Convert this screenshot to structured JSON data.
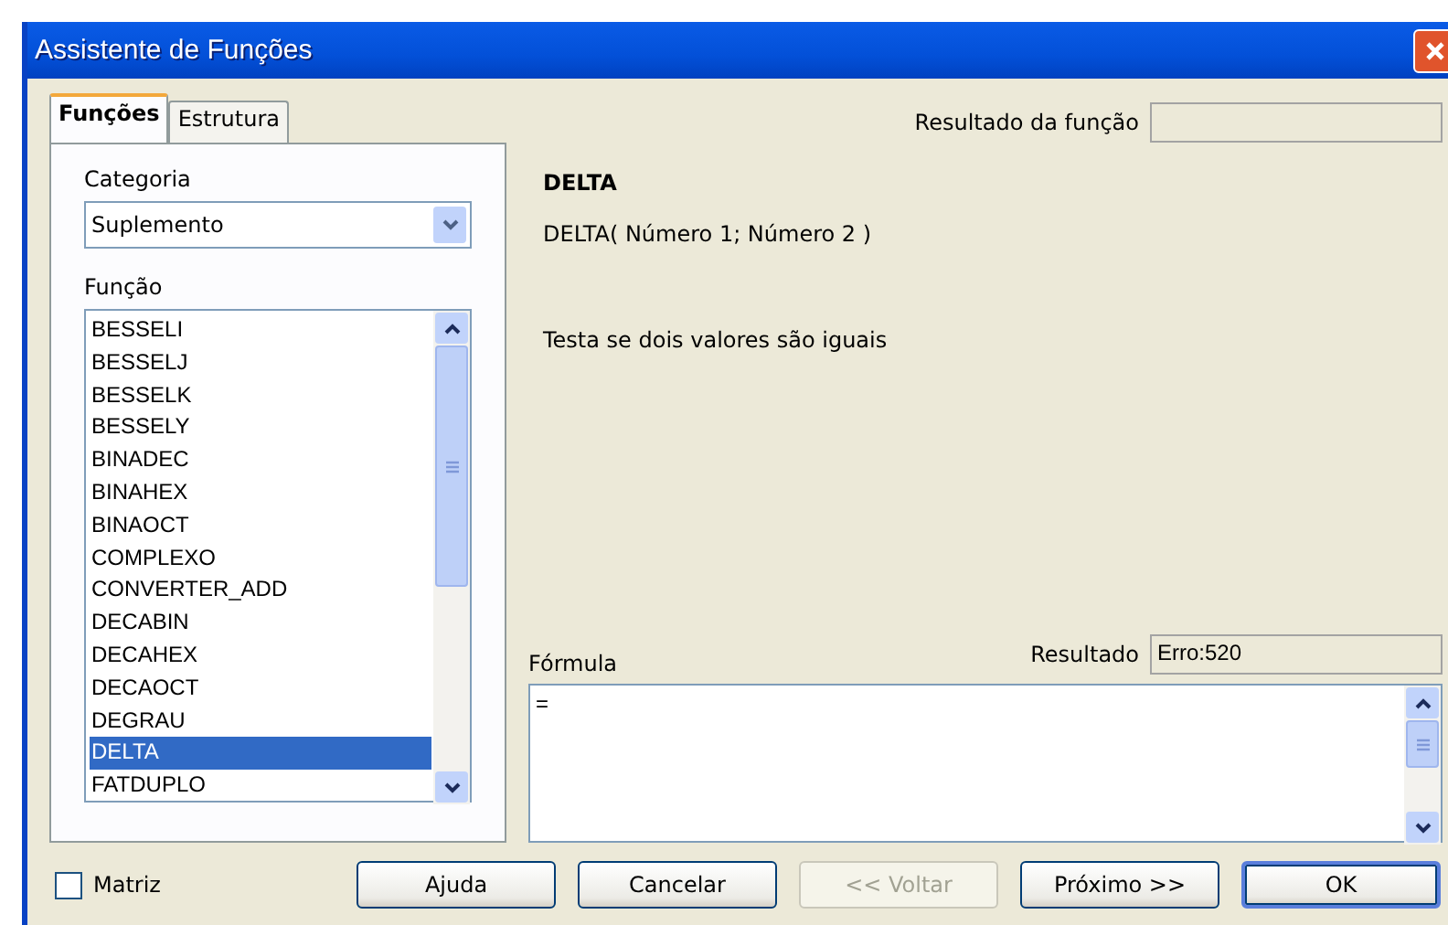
{
  "window": {
    "title": "Assistente de Funções"
  },
  "tabs": [
    {
      "label": "Funções",
      "selected": true
    },
    {
      "label": "Estrutura",
      "selected": false
    }
  ],
  "category": {
    "label": "Categoria",
    "value": "Suplemento"
  },
  "function_list": {
    "label": "Função",
    "items": [
      {
        "label": "BESSELI",
        "selected": false
      },
      {
        "label": "BESSELJ",
        "selected": false
      },
      {
        "label": "BESSELK",
        "selected": false
      },
      {
        "label": "BESSELY",
        "selected": false
      },
      {
        "label": "BINADEC",
        "selected": false
      },
      {
        "label": "BINAHEX",
        "selected": false
      },
      {
        "label": "BINAOCT",
        "selected": false
      },
      {
        "label": "COMPLEXO",
        "selected": false
      },
      {
        "label": "CONVERTER_ADD",
        "selected": false
      },
      {
        "label": "DECABIN",
        "selected": false
      },
      {
        "label": "DECAHEX",
        "selected": false
      },
      {
        "label": "DECAOCT",
        "selected": false
      },
      {
        "label": "DEGRAU",
        "selected": false
      },
      {
        "label": "DELTA",
        "selected": true
      },
      {
        "label": "FATDUPLO",
        "selected": false
      }
    ]
  },
  "function_result": {
    "label": "Resultado da função"
  },
  "detail": {
    "name": "DELTA",
    "signature": "DELTA( Número 1; Número 2 )",
    "description": "Testa se dois valores são iguais"
  },
  "formula": {
    "label": "Fórmula",
    "value": "="
  },
  "result": {
    "label": "Resultado",
    "value": "Erro:520"
  },
  "array": {
    "label": "Matriz",
    "checked": false
  },
  "buttons": [
    {
      "label": "Ajuda",
      "disabled": false,
      "default": false
    },
    {
      "label": "Cancelar",
      "disabled": false,
      "default": false
    },
    {
      "label": "<< Voltar",
      "disabled": true,
      "default": false
    },
    {
      "label": "Próximo >>",
      "disabled": false,
      "default": false
    },
    {
      "label": "OK",
      "disabled": false,
      "default": true
    }
  ]
}
